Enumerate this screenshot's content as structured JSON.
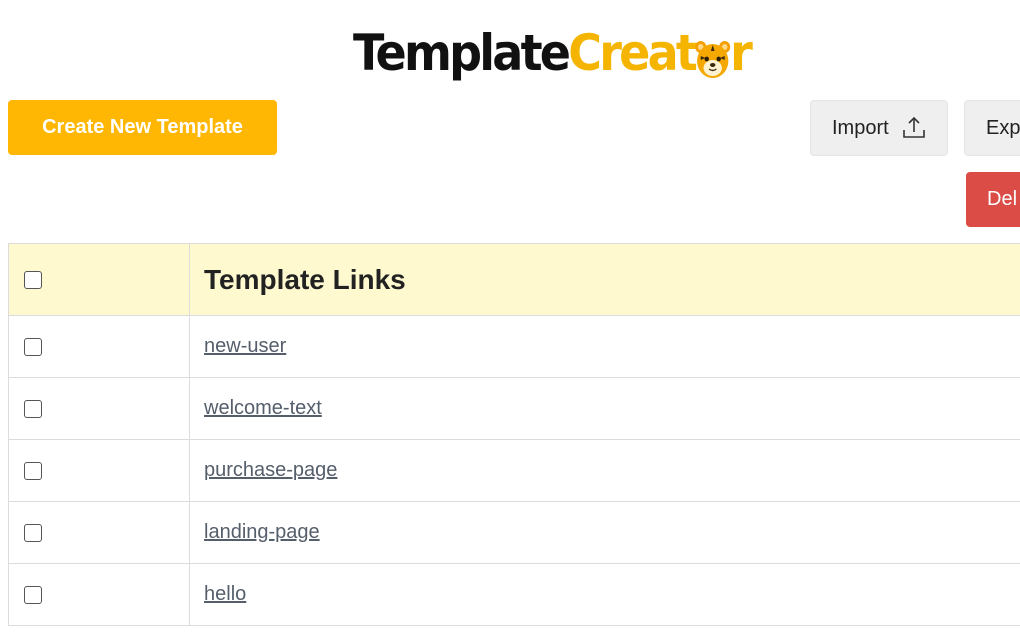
{
  "logo": {
    "part_a": "Template",
    "part_b_before": "Creat",
    "part_b_after": "r",
    "mascot_icon": "tiger-face-icon",
    "color_a": "#111111",
    "color_b": "#f5b400"
  },
  "toolbar": {
    "create_label": "Create New Template",
    "import_label": "Import",
    "import_icon": "upload-icon",
    "export_label": "Exp",
    "delete_label": "Del"
  },
  "table": {
    "header": "Template Links",
    "header_bg": "#fff9d0",
    "rows": [
      {
        "label": "new-user"
      },
      {
        "label": "welcome-text"
      },
      {
        "label": "purchase-page"
      },
      {
        "label": "landing-page"
      },
      {
        "label": "hello"
      }
    ]
  },
  "colors": {
    "accent": "#ffb703",
    "danger": "#db4c46",
    "link": "#555e6b"
  }
}
